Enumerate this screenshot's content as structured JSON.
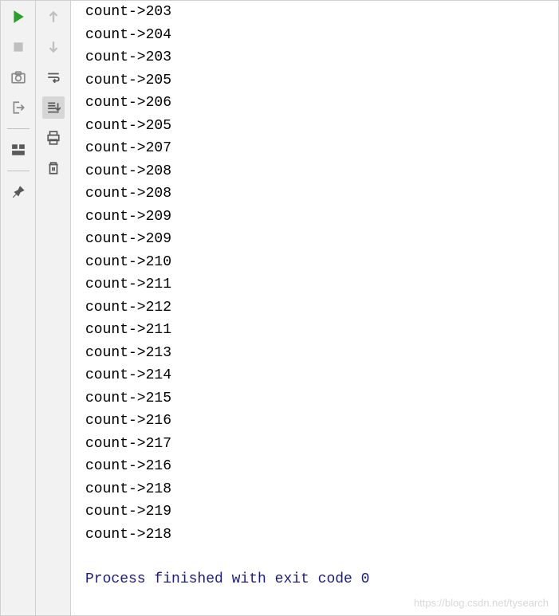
{
  "toolbar1": {
    "run": "run",
    "stop": "stop",
    "camera": "camera",
    "exit": "exit",
    "layout": "layout",
    "pin": "pin"
  },
  "toolbar2": {
    "up": "up",
    "down": "down",
    "wrap": "wrap",
    "scroll": "scroll",
    "print": "print",
    "delete": "delete"
  },
  "console": {
    "lines": [
      "count->203",
      "count->204",
      "count->203",
      "count->205",
      "count->206",
      "count->205",
      "count->207",
      "count->208",
      "count->208",
      "count->209",
      "count->209",
      "count->210",
      "count->211",
      "count->212",
      "count->211",
      "count->213",
      "count->214",
      "count->215",
      "count->216",
      "count->217",
      "count->216",
      "count->218",
      "count->219",
      "count->218"
    ],
    "exit_message": "Process finished with exit code 0"
  },
  "watermark": "https://blog.csdn.net/tysearch"
}
